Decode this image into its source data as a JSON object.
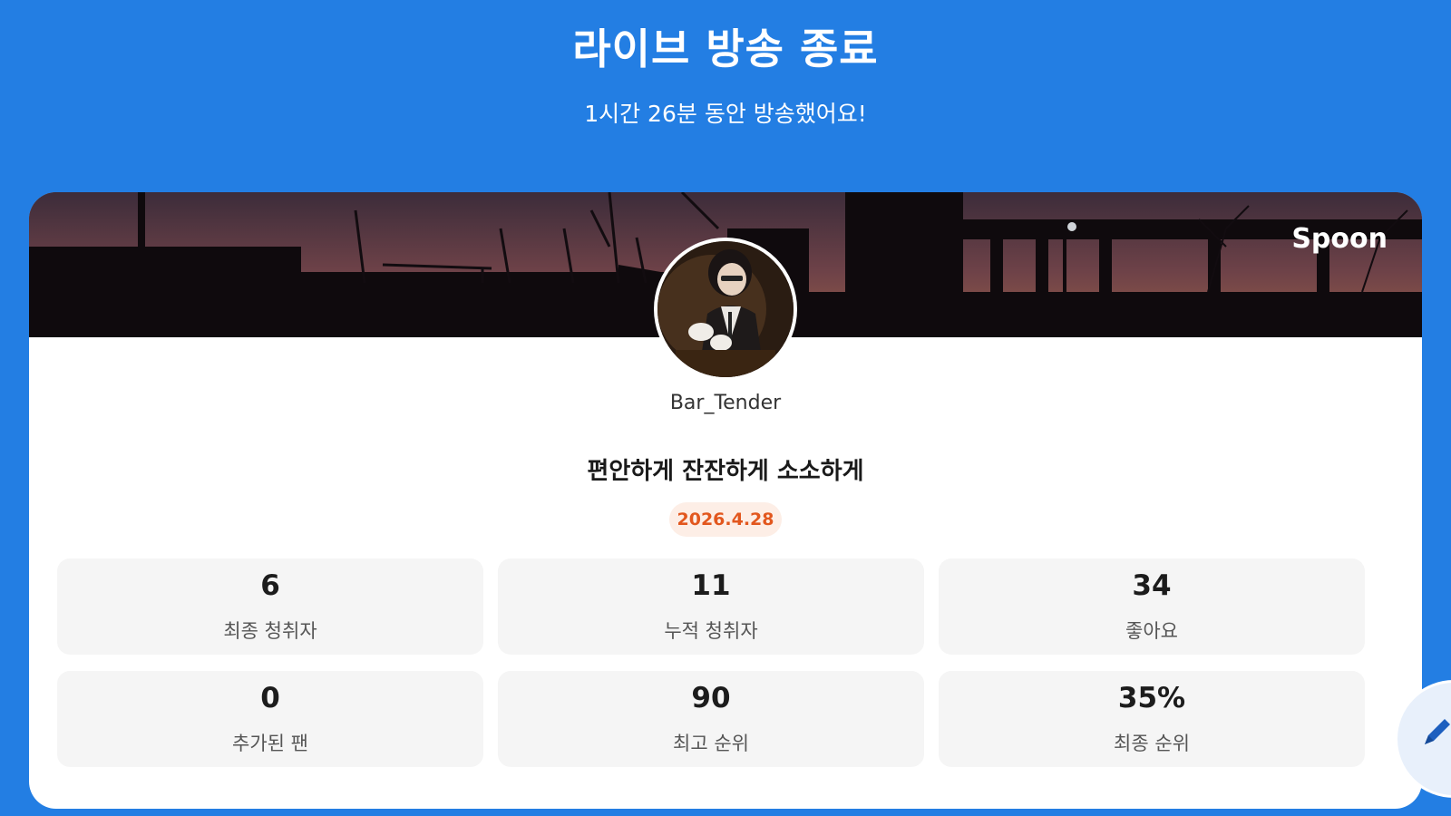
{
  "header": {
    "title": "라이브 방송 종료",
    "subtitle": "1시간 26분 동안 방송했어요!"
  },
  "card": {
    "brand": "Spoon",
    "username": "Bar_Tender",
    "room_title": "편안하게 잔잔하게 소소하게",
    "date": "2026.4.28",
    "date_badge_color": "#e2571e"
  },
  "stats": [
    {
      "value": "6",
      "label": "최종 청취자"
    },
    {
      "value": "11",
      "label": "누적 청취자"
    },
    {
      "value": "34",
      "label": "좋아요"
    },
    {
      "value": "0",
      "label": "추가된 팬"
    },
    {
      "value": "90",
      "label": "최고 순위"
    },
    {
      "value": "35%",
      "label": "최종 순위"
    }
  ],
  "fab": {
    "icon": "pencil-icon"
  },
  "colors": {
    "accent": "#237ee3",
    "card": "#ffffff",
    "stat_bg": "#f5f5f5"
  }
}
